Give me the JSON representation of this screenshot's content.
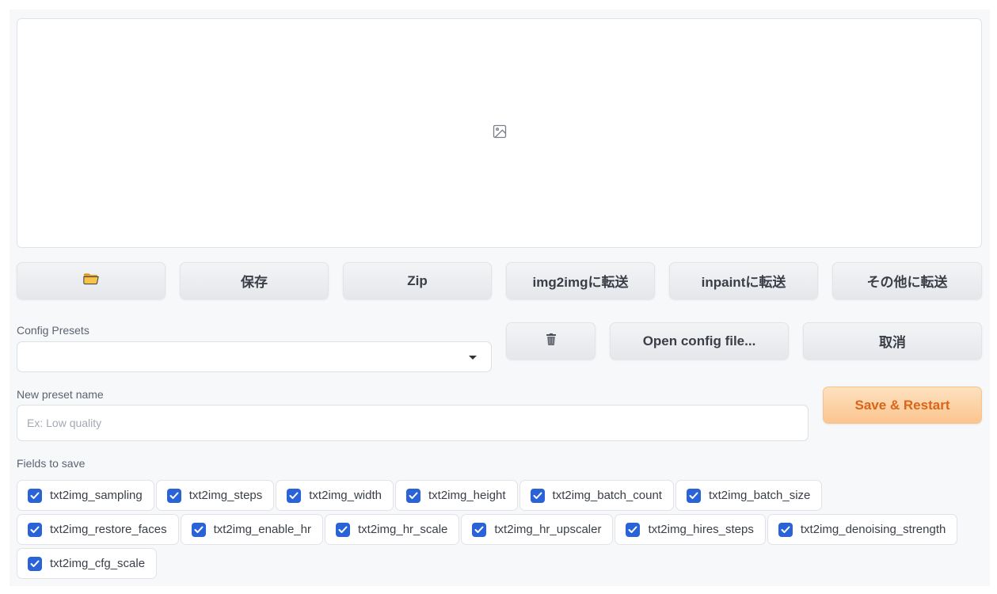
{
  "gallery": {
    "placeholder_icon": "image-icon"
  },
  "actions": {
    "open_folder_icon": "folder-icon",
    "save_label": "保存",
    "zip_label": "Zip",
    "send_img2img_label": "img2imgに転送",
    "send_inpaint_label": "inpaintに転送",
    "send_other_label": "その他に転送"
  },
  "config": {
    "presets_label": "Config Presets",
    "preset_value": "",
    "delete_icon": "trash-icon",
    "open_config_label": "Open config file...",
    "cancel_label": "取消",
    "new_preset_label": "New preset name",
    "new_preset_placeholder": "Ex: Low quality",
    "save_restart_label": "Save & Restart",
    "fields_label": "Fields to save"
  },
  "fields": [
    {
      "label": "txt2img_sampling",
      "checked": true
    },
    {
      "label": "txt2img_steps",
      "checked": true
    },
    {
      "label": "txt2img_width",
      "checked": true
    },
    {
      "label": "txt2img_height",
      "checked": true
    },
    {
      "label": "txt2img_batch_count",
      "checked": true
    },
    {
      "label": "txt2img_batch_size",
      "checked": true
    },
    {
      "label": "txt2img_restore_faces",
      "checked": true
    },
    {
      "label": "txt2img_enable_hr",
      "checked": true
    },
    {
      "label": "txt2img_hr_scale",
      "checked": true
    },
    {
      "label": "txt2img_hr_upscaler",
      "checked": true
    },
    {
      "label": "txt2img_hires_steps",
      "checked": true
    },
    {
      "label": "txt2img_denoising_strength",
      "checked": true
    },
    {
      "label": "txt2img_cfg_scale",
      "checked": true
    }
  ],
  "colors": {
    "accent": "#2a62d7",
    "primary_text": "#d9651a",
    "primary_bg": "#fbc58f"
  }
}
